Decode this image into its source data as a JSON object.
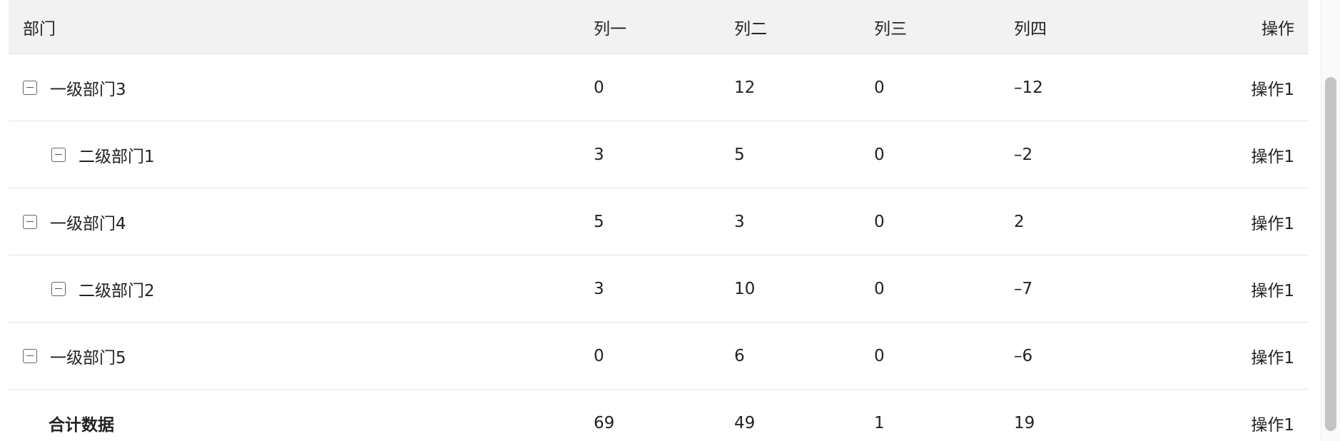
{
  "table": {
    "headers": {
      "dept": "部门",
      "col1": "列一",
      "col2": "列二",
      "col3": "列三",
      "col4": "列四",
      "op": "操作"
    },
    "rows": [
      {
        "name": "一级部门3",
        "level": 1,
        "expanded": true,
        "col1": "0",
        "col2": "12",
        "col3": "0",
        "col4": "–12",
        "op": "操作1"
      },
      {
        "name": "二级部门1",
        "level": 2,
        "expanded": true,
        "col1": "3",
        "col2": "5",
        "col3": "0",
        "col4": "–2",
        "op": "操作1"
      },
      {
        "name": "一级部门4",
        "level": 1,
        "expanded": true,
        "col1": "5",
        "col2": "3",
        "col3": "0",
        "col4": "2",
        "op": "操作1"
      },
      {
        "name": "二级部门2",
        "level": 2,
        "expanded": true,
        "col1": "3",
        "col2": "10",
        "col3": "0",
        "col4": "–7",
        "op": "操作1"
      },
      {
        "name": "一级部门5",
        "level": 1,
        "expanded": true,
        "col1": "0",
        "col2": "6",
        "col3": "0",
        "col4": "–6",
        "op": "操作1"
      }
    ],
    "total": {
      "name": "合计数据",
      "col1": "69",
      "col2": "49",
      "col3": "1",
      "col4": "19",
      "op": "操作1"
    }
  },
  "icons": {
    "toggle": "collapse-square-icon"
  },
  "colors": {
    "header_bg": "#f2f2f2",
    "border": "#e5e5e5",
    "text": "#222222"
  }
}
